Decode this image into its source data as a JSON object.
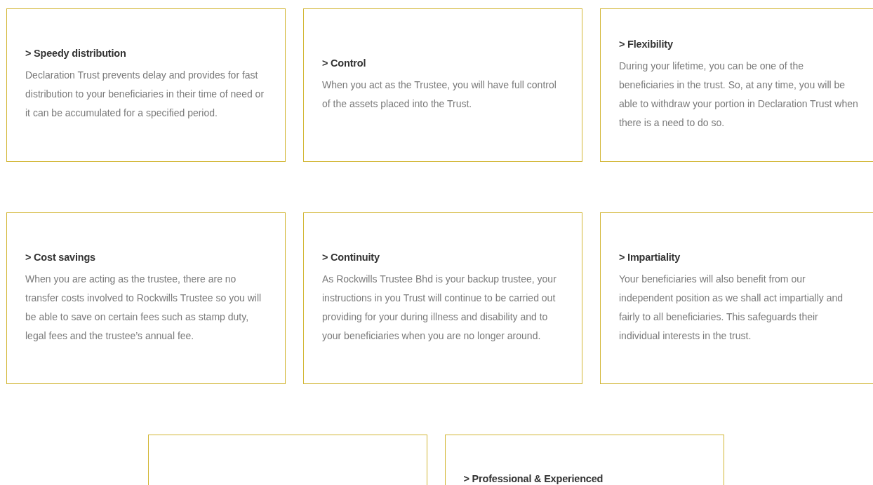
{
  "rows": [
    {
      "cards": [
        {
          "kind": "text",
          "title": "> Speedy distribution",
          "body": "Declaration Trust prevents delay and provides for fast distribution to your beneficiaries in their time of need or it can be accumulated for a specified period."
        },
        {
          "kind": "text",
          "title": "> Control",
          "body": "When you act as the Trustee, you will have full control of the assets placed into the Trust."
        },
        {
          "kind": "text",
          "title": "> Flexibility",
          "body": "During your lifetime, you can be one of the beneficiaries in the trust. So, at any time, you will be able to withdraw your portion in Declaration Trust when there is a need to do so."
        }
      ]
    },
    {
      "cards": [
        {
          "kind": "text",
          "title": "> Cost savings",
          "body": "When you are acting as the trustee, there are no transfer costs involved to Rockwills Trustee so you will be able to save on certain fees such as stamp duty, legal fees and the trustee’s annual fee."
        },
        {
          "kind": "text",
          "title": "> Continuity",
          "body": "As Rockwills Trustee Bhd is your backup trustee, your instructions in you Trust will continue to be carried out providing for your during illness and disability and to your beneficiaries when you are no longer around."
        },
        {
          "kind": "text",
          "title": "> Impartiality",
          "body": "Your beneficiaries will also benefit from our independent position as we shall act impartially and fairly to all beneficiaries. This safeguards their individual interests in the trust."
        }
      ]
    },
    {
      "cards": [
        {
          "kind": "blank"
        },
        {
          "kind": "heading",
          "title": "> Professional & Experienced"
        }
      ]
    }
  ]
}
